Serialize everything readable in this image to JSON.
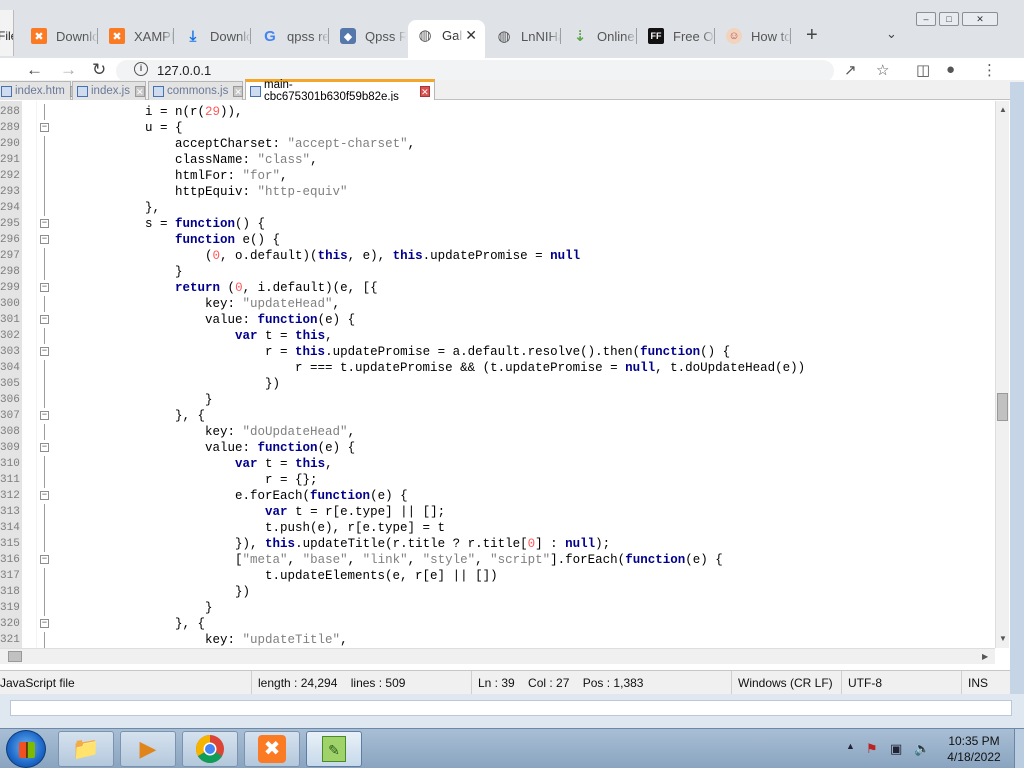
{
  "browser": {
    "file_menu_fragment": "File",
    "tabs": [
      {
        "label": "Downloads",
        "icon": "xampp-icon"
      },
      {
        "label": "XAMPP",
        "icon": "xampp-icon"
      },
      {
        "label": "Downloads",
        "icon": "download-icon"
      },
      {
        "label": "qpss repo",
        "icon": "google-icon"
      },
      {
        "label": "Qpss Res",
        "icon": "qpss-icon"
      },
      {
        "label": "Gallery",
        "icon": "globe-icon"
      },
      {
        "label": "LnNIHa",
        "icon": "globe-icon"
      },
      {
        "label": "Online",
        "icon": "leaf-icon"
      },
      {
        "label": "Free Online",
        "icon": "ff-icon"
      },
      {
        "label": "How to",
        "icon": "face-icon"
      }
    ],
    "new_tab": "+",
    "tab_list": "⌄",
    "window_buttons": {
      "minimize": "–",
      "maximize": "□",
      "close": "✕"
    },
    "url": "127.0.0.1"
  },
  "npp": {
    "tabs": [
      {
        "label": "index.htm",
        "close": "✕"
      },
      {
        "label": "index.js",
        "close": "✕"
      },
      {
        "label": "commons.js",
        "close": "✕"
      },
      {
        "label": "main-cbc675301b630f59b82e.js",
        "close": "✕"
      }
    ],
    "lines": [
      {
        "n": "288",
        "fold": "",
        "segs": [
          [
            "",
            "            i = n(r("
          ],
          [
            "num",
            "29"
          ],
          [
            "",
            ")),"
          ]
        ]
      },
      {
        "n": "289",
        "fold": "−",
        "segs": [
          [
            "",
            "            u = {"
          ]
        ]
      },
      {
        "n": "290",
        "fold": "",
        "segs": [
          [
            "",
            "                acceptCharset: "
          ],
          [
            "str",
            "\"accept-charset\""
          ],
          [
            "",
            ","
          ]
        ]
      },
      {
        "n": "291",
        "fold": "",
        "segs": [
          [
            "",
            "                className: "
          ],
          [
            "str",
            "\"class\""
          ],
          [
            "",
            ","
          ]
        ]
      },
      {
        "n": "292",
        "fold": "",
        "segs": [
          [
            "",
            "                htmlFor: "
          ],
          [
            "str",
            "\"for\""
          ],
          [
            "",
            ","
          ]
        ]
      },
      {
        "n": "293",
        "fold": "",
        "segs": [
          [
            "",
            "                httpEquiv: "
          ],
          [
            "str",
            "\"http-equiv\""
          ]
        ]
      },
      {
        "n": "294",
        "fold": "",
        "segs": [
          [
            "",
            "            },"
          ]
        ]
      },
      {
        "n": "295",
        "fold": "−",
        "segs": [
          [
            "",
            "            s = "
          ],
          [
            "kw",
            "function"
          ],
          [
            "",
            "() {"
          ]
        ]
      },
      {
        "n": "296",
        "fold": "−",
        "segs": [
          [
            "",
            "                "
          ],
          [
            "kw",
            "function"
          ],
          [
            "",
            " e() {"
          ]
        ]
      },
      {
        "n": "297",
        "fold": "",
        "segs": [
          [
            "",
            "                    ("
          ],
          [
            "num",
            "0"
          ],
          [
            "",
            ", o.default)("
          ],
          [
            "kw",
            "this"
          ],
          [
            "",
            ", e), "
          ],
          [
            "kw",
            "this"
          ],
          [
            "",
            ".updatePromise = "
          ],
          [
            "kw",
            "null"
          ]
        ]
      },
      {
        "n": "298",
        "fold": "",
        "segs": [
          [
            "",
            "                }"
          ]
        ]
      },
      {
        "n": "299",
        "fold": "−",
        "segs": [
          [
            "",
            "                "
          ],
          [
            "kw",
            "return"
          ],
          [
            "",
            " ("
          ],
          [
            "num",
            "0"
          ],
          [
            "",
            ", i.default)(e, [{"
          ]
        ]
      },
      {
        "n": "300",
        "fold": "",
        "segs": [
          [
            "",
            "                    key: "
          ],
          [
            "str",
            "\"updateHead\""
          ],
          [
            "",
            ","
          ]
        ]
      },
      {
        "n": "301",
        "fold": "−",
        "segs": [
          [
            "",
            "                    value: "
          ],
          [
            "kw",
            "function"
          ],
          [
            "",
            "(e) {"
          ]
        ]
      },
      {
        "n": "302",
        "fold": "",
        "segs": [
          [
            "",
            "                        "
          ],
          [
            "kw",
            "var"
          ],
          [
            "",
            " t = "
          ],
          [
            "kw",
            "this"
          ],
          [
            "",
            ","
          ]
        ]
      },
      {
        "n": "303",
        "fold": "−",
        "segs": [
          [
            "",
            "                            r = "
          ],
          [
            "kw",
            "this"
          ],
          [
            "",
            ".updatePromise = a.default.resolve().then("
          ],
          [
            "kw",
            "function"
          ],
          [
            "",
            "() {"
          ]
        ]
      },
      {
        "n": "304",
        "fold": "",
        "segs": [
          [
            "",
            "                                r === t.updatePromise && (t.updatePromise = "
          ],
          [
            "kw",
            "null"
          ],
          [
            "",
            ", t.doUpdateHead(e))"
          ]
        ]
      },
      {
        "n": "305",
        "fold": "",
        "segs": [
          [
            "",
            "                            })"
          ]
        ]
      },
      {
        "n": "306",
        "fold": "",
        "segs": [
          [
            "",
            "                    }"
          ]
        ]
      },
      {
        "n": "307",
        "fold": "−",
        "segs": [
          [
            "",
            "                }, {"
          ]
        ]
      },
      {
        "n": "308",
        "fold": "",
        "segs": [
          [
            "",
            "                    key: "
          ],
          [
            "str",
            "\"doUpdateHead\""
          ],
          [
            "",
            ","
          ]
        ]
      },
      {
        "n": "309",
        "fold": "−",
        "segs": [
          [
            "",
            "                    value: "
          ],
          [
            "kw",
            "function"
          ],
          [
            "",
            "(e) {"
          ]
        ]
      },
      {
        "n": "310",
        "fold": "",
        "segs": [
          [
            "",
            "                        "
          ],
          [
            "kw",
            "var"
          ],
          [
            "",
            " t = "
          ],
          [
            "kw",
            "this"
          ],
          [
            "",
            ","
          ]
        ]
      },
      {
        "n": "311",
        "fold": "",
        "segs": [
          [
            "",
            "                            r = {};"
          ]
        ]
      },
      {
        "n": "312",
        "fold": "−",
        "segs": [
          [
            "",
            "                        e.forEach("
          ],
          [
            "kw",
            "function"
          ],
          [
            "",
            "(e) {"
          ]
        ]
      },
      {
        "n": "313",
        "fold": "",
        "segs": [
          [
            "",
            "                            "
          ],
          [
            "kw",
            "var"
          ],
          [
            "",
            " t = r[e.type] || [];"
          ]
        ]
      },
      {
        "n": "314",
        "fold": "",
        "segs": [
          [
            "",
            "                            t.push(e), r[e.type] = t"
          ]
        ]
      },
      {
        "n": "315",
        "fold": "",
        "segs": [
          [
            "",
            "                        }), "
          ],
          [
            "kw",
            "this"
          ],
          [
            "",
            ".updateTitle(r.title ? r.title["
          ],
          [
            "num",
            "0"
          ],
          [
            "",
            "] : "
          ],
          [
            "kw",
            "null"
          ],
          [
            "",
            ");"
          ]
        ]
      },
      {
        "n": "316",
        "fold": "−",
        "segs": [
          [
            "",
            "                        ["
          ],
          [
            "str",
            "\"meta\""
          ],
          [
            "",
            ", "
          ],
          [
            "str",
            "\"base\""
          ],
          [
            "",
            ", "
          ],
          [
            "str",
            "\"link\""
          ],
          [
            "",
            ", "
          ],
          [
            "str",
            "\"style\""
          ],
          [
            "",
            ", "
          ],
          [
            "str",
            "\"script\""
          ],
          [
            "",
            "].forEach("
          ],
          [
            "kw",
            "function"
          ],
          [
            "",
            "(e) {"
          ]
        ]
      },
      {
        "n": "317",
        "fold": "",
        "segs": [
          [
            "",
            "                            t.updateElements(e, r[e] || [])"
          ]
        ]
      },
      {
        "n": "318",
        "fold": "",
        "segs": [
          [
            "",
            "                        })"
          ]
        ]
      },
      {
        "n": "319",
        "fold": "",
        "segs": [
          [
            "",
            "                    }"
          ]
        ]
      },
      {
        "n": "320",
        "fold": "−",
        "segs": [
          [
            "",
            "                }, {"
          ]
        ]
      },
      {
        "n": "321",
        "fold": "",
        "segs": [
          [
            "",
            "                    key: "
          ],
          [
            "str",
            "\"updateTitle\""
          ],
          [
            "",
            ","
          ]
        ]
      }
    ],
    "status": {
      "file_type": "JavaScript file",
      "length": "length : 24,294",
      "lines": "lines : 509",
      "ln": "Ln : 39",
      "col": "Col : 27",
      "pos": "Pos : 1,383",
      "eol": "Windows (CR LF)",
      "encoding": "UTF-8",
      "mode": "INS"
    }
  },
  "taskbar": {
    "time": "10:35 PM",
    "date": "4/18/2022"
  }
}
